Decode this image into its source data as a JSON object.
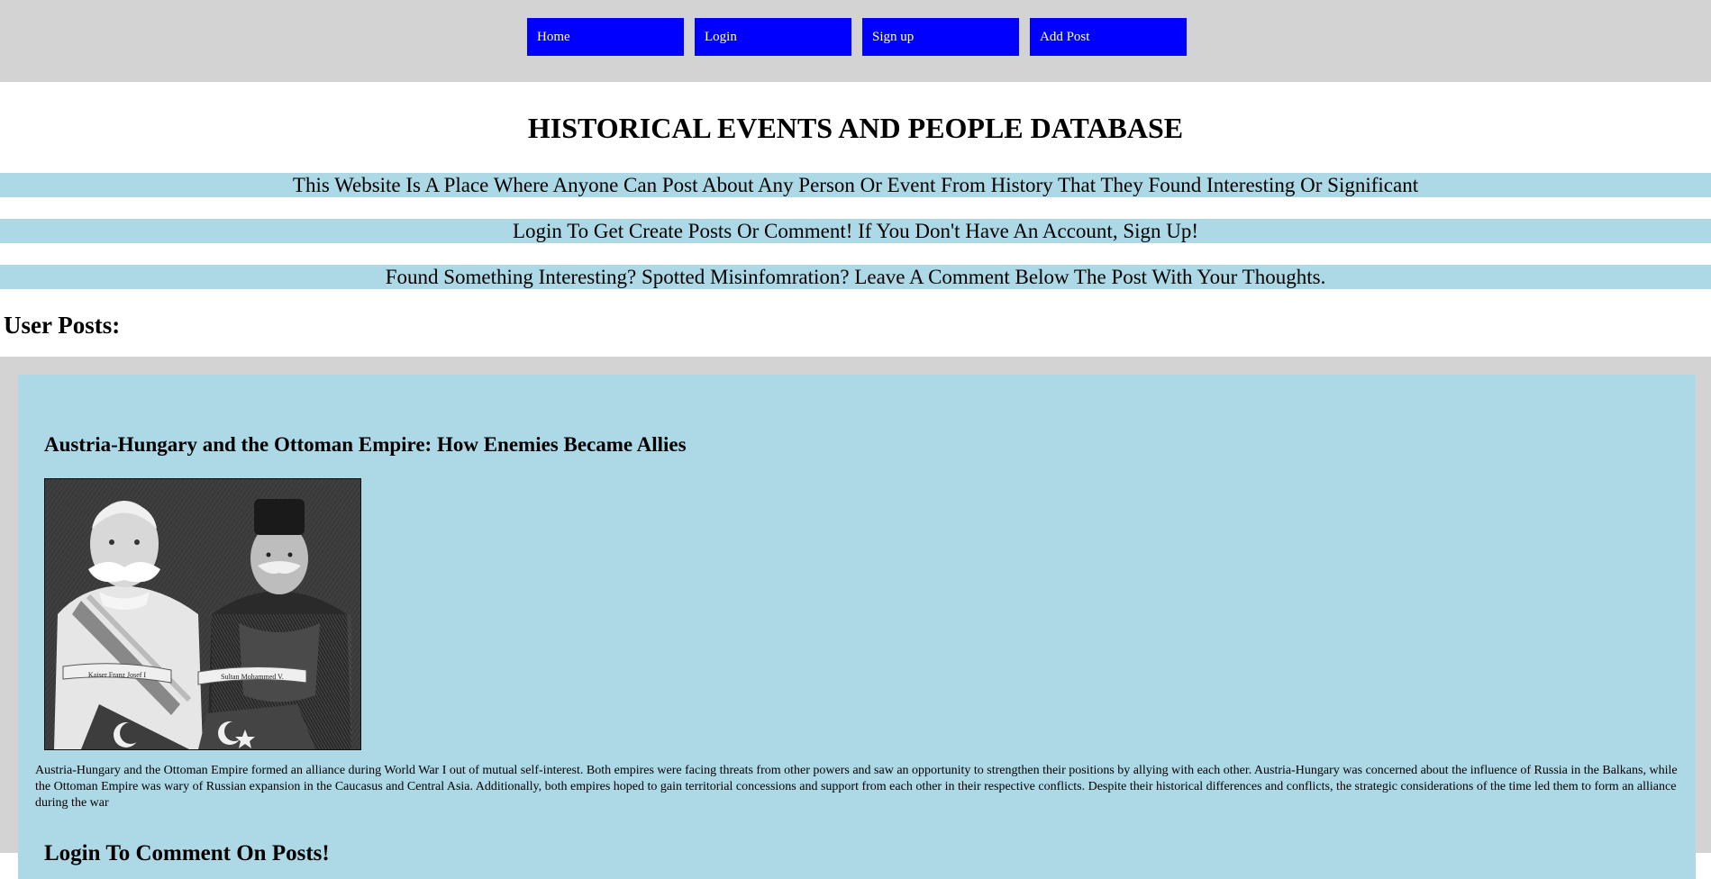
{
  "nav": {
    "items": [
      {
        "label": "Home"
      },
      {
        "label": "Login"
      },
      {
        "label": "Sign up"
      },
      {
        "label": "Add Post"
      }
    ]
  },
  "header": {
    "title": "HISTORICAL EVENTS AND PEOPLE DATABASE"
  },
  "info_lines": [
    "This Website Is A Place Where Anyone Can Post About Any Person Or Event From History That They Found Interesting Or Significant",
    "Login To Get Create Posts Or Comment! If You Don't Have An Account, Sign Up!",
    "Found Something Interesting? Spotted Misinfomration? Leave A Comment Below The Post With Your Thoughts."
  ],
  "posts_section": {
    "heading": "User Posts:"
  },
  "post": {
    "title": "Austria-Hungary and the Ottoman Empire: How Enemies Became Allies",
    "image_ribbon_left": "Kaiser Franz Josef I",
    "image_ribbon_right": "Sultan Mohammed V.",
    "body": "Austria-Hungary and the Ottoman Empire formed an alliance during World War I out of mutual self-interest. Both empires were facing threats from other powers and saw an opportunity to strengthen their positions by allying with each other. Austria-Hungary was concerned about the influence of Russia in the Balkans, while the Ottoman Empire was wary of Russian expansion in the Caucasus and Central Asia. Additionally, both empires hoped to gain territorial concessions and support from each other in their respective conflicts. Despite their historical differences and conflicts, the strategic considerations of the time led them to form an alliance during the war",
    "comment_prompt": "Login To Comment On Posts!"
  },
  "colors": {
    "nav_background": "#d3d3d3",
    "nav_button": "#0000ff",
    "info_band": "#add8e6",
    "post_card": "#add8e6"
  }
}
